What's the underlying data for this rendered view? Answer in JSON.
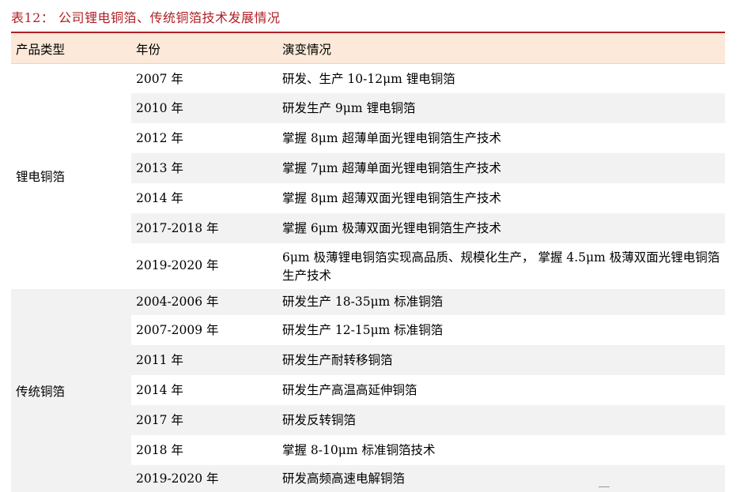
{
  "table": {
    "title": "表12：  公司锂电铜箔、传统铜箔技术发展情况",
    "headers": [
      "产品类型",
      "年份",
      "演变情况"
    ],
    "groups": [
      {
        "name": "锂电铜箔",
        "rows": [
          {
            "year": "2007 年",
            "desc": "研发、生产 10-12μm 锂电铜箔"
          },
          {
            "year": "2010 年",
            "desc": "研发生产 9μm 锂电铜箔"
          },
          {
            "year": "2012 年",
            "desc": "掌握 8μm 超薄单面光锂电铜箔生产技术"
          },
          {
            "year": "2013 年",
            "desc": "掌握 7μm 超薄单面光锂电铜箔生产技术"
          },
          {
            "year": "2014 年",
            "desc": "掌握 8μm 超薄双面光锂电铜箔生产技术"
          },
          {
            "year": "2017-2018 年",
            "desc": "掌握 6μm 极薄双面光锂电铜箔生产技术"
          },
          {
            "year": "2019-2020 年",
            "desc": "6μm 极薄锂电铜箔实现高品质、规模化生产， 掌握 4.5μm 极薄双面光锂电铜箔生产技术"
          }
        ]
      },
      {
        "name": "传统铜箔",
        "rows": [
          {
            "year": "2004-2006 年",
            "desc": "研发生产 18-35μm 标准铜箔"
          },
          {
            "year": "2007-2009 年",
            "desc": "研发生产 12-15μm 标准铜箔"
          },
          {
            "year": "2011 年",
            "desc": "研发生产耐转移铜箔"
          },
          {
            "year": "2014 年",
            "desc": "研发生产高温高延伸铜箔"
          },
          {
            "year": "2017 年",
            "desc": "研发反转铜箔"
          },
          {
            "year": "2018 年",
            "desc": "掌握 8-10μm 标准铜箔技术"
          },
          {
            "year": "2019-2020 年",
            "desc": "研发高频高速电解铜箔"
          }
        ]
      }
    ]
  }
}
